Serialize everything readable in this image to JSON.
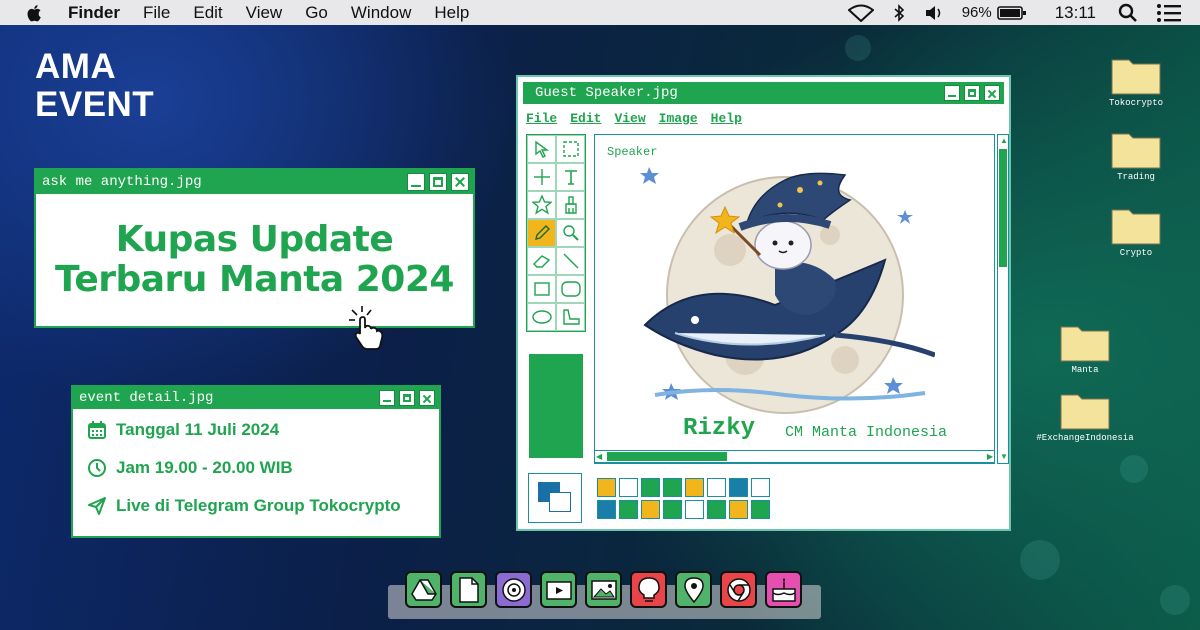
{
  "menubar": {
    "app": "Finder",
    "items": [
      "File",
      "Edit",
      "View",
      "Go",
      "Window",
      "Help"
    ],
    "battery": "96%",
    "clock": "13:11"
  },
  "heading": {
    "line1": "AMA",
    "line2": "EVENT"
  },
  "ask_window": {
    "title": "ask me anything.jpg",
    "line1": "Kupas Update",
    "line2": "Terbaru Manta 2024"
  },
  "event_window": {
    "title": "event detail.jpg",
    "date": "Tanggal 11 Juli 2024",
    "time": "Jam 19.00 - 20.00 WIB",
    "location": "Live di Telegram Group Tokocrypto"
  },
  "paint_window": {
    "title": "Guest Speaker.jpg",
    "menu": [
      "File",
      "Edit",
      "View",
      "Image",
      "Help"
    ],
    "canvas_label": "Speaker",
    "speaker_name": "Rizky",
    "speaker_role": "CM Manta Indonesia",
    "palette": [
      "#f2b51b",
      "#ffffff",
      "#1fa44f",
      "#1fa44f",
      "#f2b51b",
      "#ffffff",
      "#1a7fa8",
      "#ffffff",
      "#1a7fa8",
      "#1fa44f",
      "#f2b51b",
      "#1fa44f",
      "#ffffff",
      "#1fa44f",
      "#f2b51b",
      "#1fa44f"
    ]
  },
  "folders": [
    {
      "label": "Tokocrypto"
    },
    {
      "label": "Trading"
    },
    {
      "label": "Crypto"
    },
    {
      "label": "Manta"
    },
    {
      "label": "#ExchangeIndonesia"
    }
  ],
  "dock": {
    "items": [
      {
        "icon": "drive-icon",
        "color": "#4fb36a"
      },
      {
        "icon": "file-icon",
        "color": "#4fb36a"
      },
      {
        "icon": "podcast-icon",
        "color": "#8a6bd1"
      },
      {
        "icon": "video-icon",
        "color": "#4fb36a"
      },
      {
        "icon": "image-icon",
        "color": "#4fb36a"
      },
      {
        "icon": "lightbulb-icon",
        "color": "#e8454b"
      },
      {
        "icon": "location-icon",
        "color": "#4fb36a"
      },
      {
        "icon": "chrome-icon",
        "color": "#e8454b"
      },
      {
        "icon": "cake-icon",
        "color": "#e54fb0"
      }
    ]
  }
}
